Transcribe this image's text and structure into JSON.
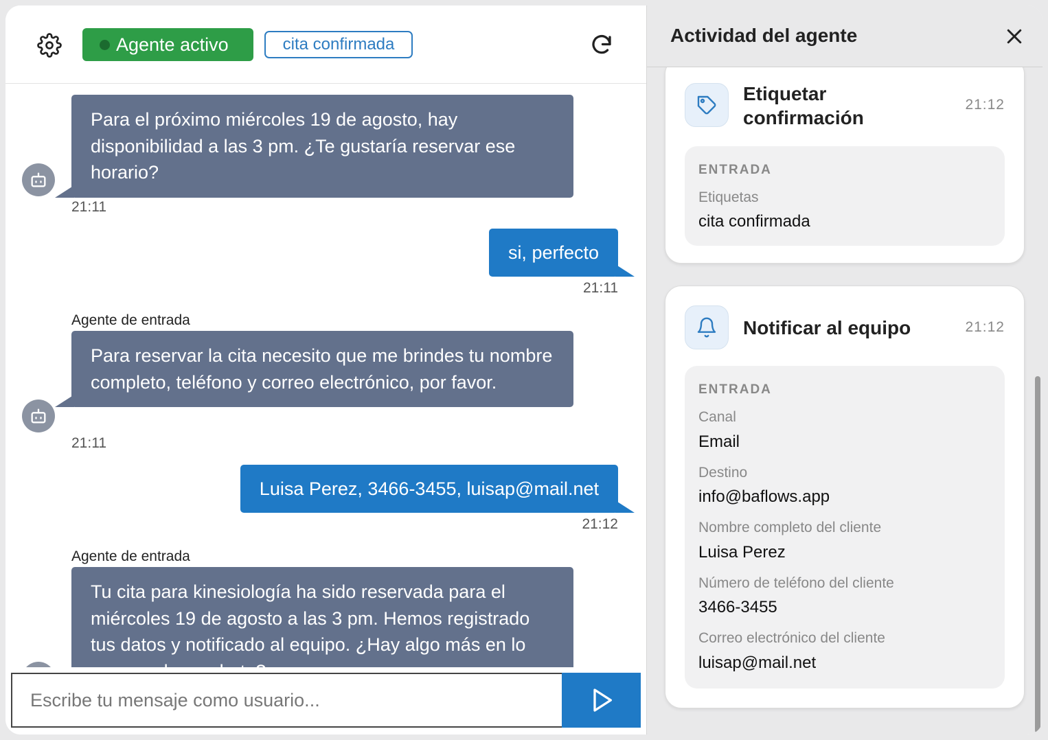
{
  "header": {
    "status_label": "Agente activo",
    "tag_label": "cita confirmada"
  },
  "messages": [
    {
      "role": "bot",
      "text": "Para el próximo miércoles 19 de agosto, hay disponibilidad a las 3 pm. ¿Te gustaría reservar ese horario?",
      "time": "21:11"
    },
    {
      "role": "user",
      "text": "si, perfecto",
      "time": "21:11"
    },
    {
      "role": "bot",
      "sender": "Agente de entrada",
      "text": "Para reservar la cita necesito que me brindes tu nombre completo, teléfono y correo electrónico, por favor.",
      "time": "21:11"
    },
    {
      "role": "user",
      "text": "Luisa Perez, 3466-3455, luisap@mail.net",
      "time": "21:12"
    },
    {
      "role": "bot",
      "sender": "Agente de entrada",
      "text": "Tu cita para kinesiología ha sido reservada para el miércoles 19 de agosto a las 3 pm. Hemos registrado tus datos y notificado al equipo. ¿Hay algo más en lo que pueda ayudarte?"
    }
  ],
  "composer": {
    "placeholder": "Escribe tu mensaje como usuario..."
  },
  "panel": {
    "title": "Actividad del agente",
    "cards": [
      {
        "title": "Etiquetar confirmación",
        "time": "21:12",
        "icon": "tag-icon",
        "section": "ENTRADA",
        "fields": [
          {
            "label": "Etiquetas",
            "value": "cita confirmada"
          }
        ]
      },
      {
        "title": "Notificar al equipo",
        "time": "21:12",
        "icon": "bell-icon",
        "section": "ENTRADA",
        "fields": [
          {
            "label": "Canal",
            "value": "Email"
          },
          {
            "label": "Destino",
            "value": "info@baflows.app"
          },
          {
            "label": "Nombre completo del cliente",
            "value": "Luisa Perez"
          },
          {
            "label": "Número de teléfono del cliente",
            "value": "3466-3455"
          },
          {
            "label": "Correo electrónico del cliente",
            "value": "luisap@mail.net"
          }
        ]
      }
    ]
  },
  "colors": {
    "accent": "#1f7ac6",
    "bot_bubble": "#63718c",
    "active": "#2e9d47"
  }
}
